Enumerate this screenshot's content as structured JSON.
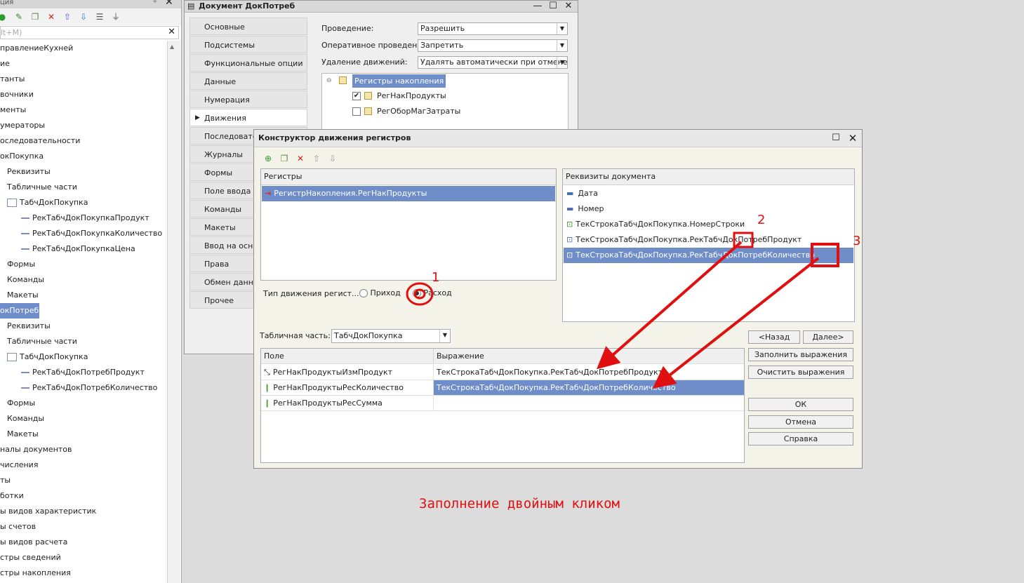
{
  "left_panel": {
    "title": "ция",
    "search_placeholder": "lt+M)",
    "tree_items": [
      "правлениеКухней",
      "ие",
      "танты",
      "вочники",
      "менты",
      "умераторы",
      "оследовательности",
      "окПокупка",
      "Реквизиты",
      "Табличные части",
      "ТабчДокПокупка",
      "РекТабчДокПокупкаПродукт",
      "РекТабчДокПокупкаКоличество",
      "РекТабчДокПокупкаЦена",
      "Формы",
      "Команды",
      "Макеты",
      "окПотреб",
      "Реквизиты",
      "Табличные части",
      "ТабчДокПокупка",
      "РекТабчДокПотребПродукт",
      "РекТабчДокПотребКоличество",
      "Формы",
      "Команды",
      "Макеты",
      "налы документов",
      "числения",
      "ты",
      "ботки",
      "ы видов характеристик",
      "ы счетов",
      "ы видов расчета",
      "стры сведений",
      "стры накопления"
    ]
  },
  "doc_window": {
    "title": "Документ ДокПотреб",
    "tabs": [
      "Основные",
      "Подсистемы",
      "Функциональные опции",
      "Данные",
      "Нумерация",
      "Движения",
      "Последовател",
      "Журналы",
      "Формы",
      "Поле ввода",
      "Команды",
      "Макеты",
      "Ввод на осно",
      "Права",
      "Обмен данны",
      "Прочее"
    ],
    "active_tab": "Движения",
    "props": [
      {
        "label": "Проведение:",
        "value": "Разрешить"
      },
      {
        "label": "Оперативное проведен...",
        "value": "Запретить"
      },
      {
        "label": "Удаление движений:",
        "value": "Удалять автоматически при отмене"
      }
    ],
    "registers_group": "Регистры накопления",
    "registers": [
      {
        "label": "РегНакПродукты",
        "checked": true
      },
      {
        "label": "РегОборМагЗатраты",
        "checked": false
      }
    ]
  },
  "constructor": {
    "title": "Конструктор движения регистров",
    "registers_header": "Регистры",
    "registers": [
      "РегистрНакопления.РегНакПродукты"
    ],
    "doc_attrs_header": "Реквизиты документа",
    "doc_attrs": [
      "Дата",
      "Номер",
      "ТекСтрокаТабчДокПокупка.НомерСтроки",
      "ТекСтрокаТабчДокПокупка.РекТабчДокПотребПродукт",
      "ТекСтрокаТабчДокПокупка.РекТабчДокПотребКоличество"
    ],
    "movement_type_label": "Тип движения регист...",
    "movement_in": "Приход",
    "movement_out": "Расход",
    "tabular_label": "Табличная часть:",
    "tabular_value": "ТабчДокПокупка",
    "grid_headers": [
      "Поле",
      "Выражение"
    ],
    "grid_rows": [
      {
        "field": "РегНакПродуктыИзмПродукт",
        "expr": "ТекСтрокаТабчДокПокупка.РекТабчДокПотребПродукт"
      },
      {
        "field": "РегНакПродуктыРесКоличество",
        "expr": "ТекСтрокаТабчДокПокупка.РекТабчДокПотребКоличество"
      },
      {
        "field": "РегНакПродуктыРесСумма",
        "expr": ""
      }
    ],
    "buttons": {
      "back": "<Назад",
      "next": "Далее>",
      "fill": "Заполнить выражения",
      "clear": "Очистить выражения",
      "ok": "ОК",
      "cancel": "Отмена",
      "help": "Справка"
    }
  },
  "annotations": {
    "n1": "1",
    "n2": "2",
    "n3": "3",
    "caption": "Заполнение двойным кликом",
    "color": "#e01010"
  }
}
